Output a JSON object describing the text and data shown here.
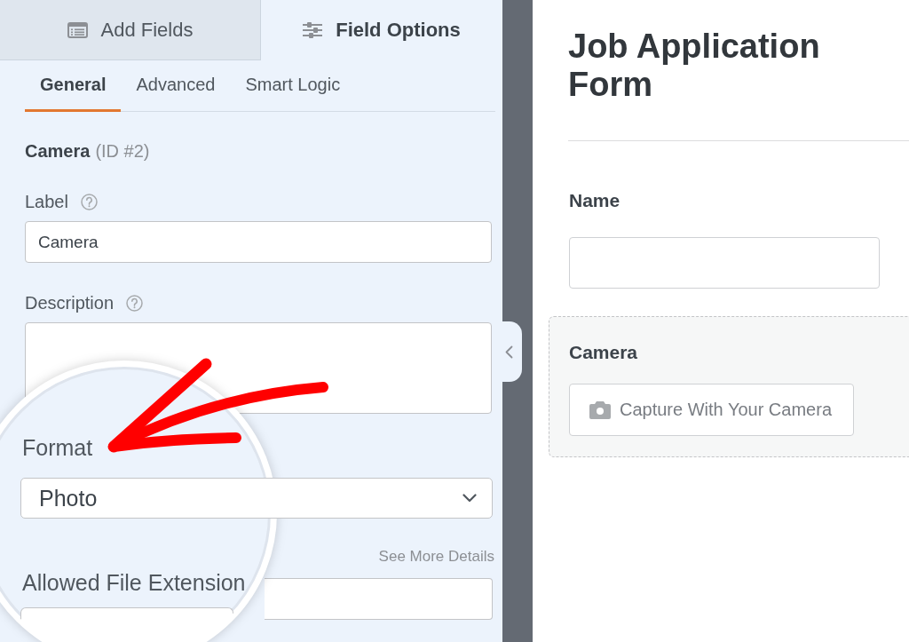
{
  "panel_tabs": [
    {
      "kind": "fields",
      "label": "Add Fields",
      "selected": false
    },
    {
      "kind": "options",
      "label": "Field Options",
      "selected": true
    }
  ],
  "settings_tabs": [
    {
      "label": "General",
      "selected": true
    },
    {
      "label": "Advanced",
      "selected": false
    },
    {
      "label": "Smart Logic",
      "selected": false
    }
  ],
  "field_heading": {
    "name": "Camera",
    "id": "(ID #2)"
  },
  "label_field": {
    "label": "Label",
    "value": "Camera"
  },
  "description_field": {
    "label": "Description"
  },
  "format_field": {
    "label": "Format",
    "value": "Photo"
  },
  "see_more_link": "See More Details",
  "extensions_field": {
    "label": "Allowed File Extension"
  },
  "form_preview": {
    "title": "Job Application Form",
    "fields": [
      {
        "kind": "text",
        "label": "Name",
        "selected": false
      },
      {
        "kind": "camera",
        "label": "Camera",
        "button": "Capture With Your Camera",
        "selected": true
      }
    ]
  }
}
